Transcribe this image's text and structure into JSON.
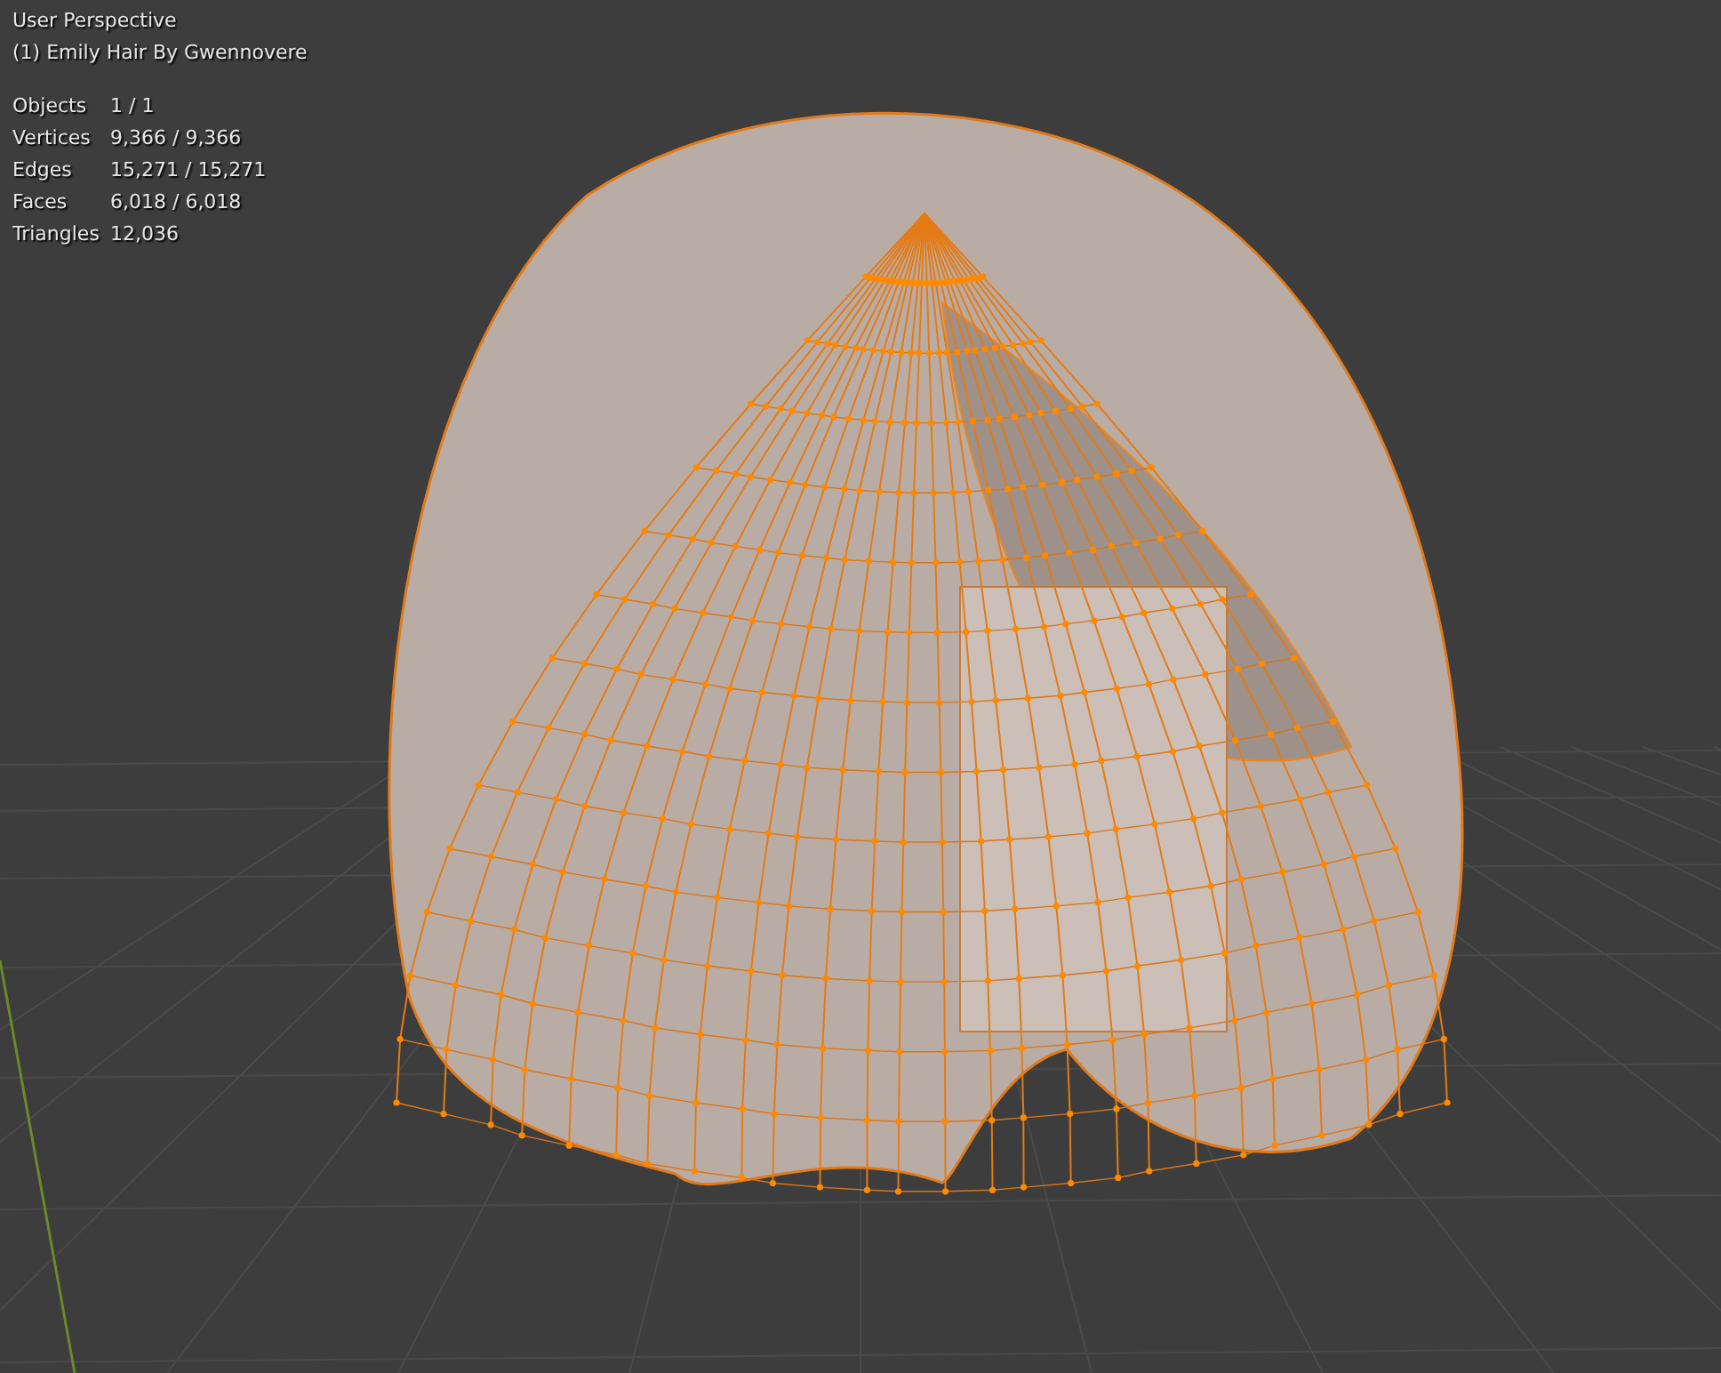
{
  "viewport": {
    "view_name": "User Perspective",
    "object_name": "(1) Emily Hair By Gwennovere"
  },
  "stats": [
    {
      "label": "Objects",
      "value": "1 / 1"
    },
    {
      "label": "Vertices",
      "value": "9,366 / 9,366"
    },
    {
      "label": "Edges",
      "value": "15,271 / 15,271"
    },
    {
      "label": "Faces",
      "value": "6,018 / 6,018"
    },
    {
      "label": "Triangles",
      "value": "12,036"
    }
  ]
}
